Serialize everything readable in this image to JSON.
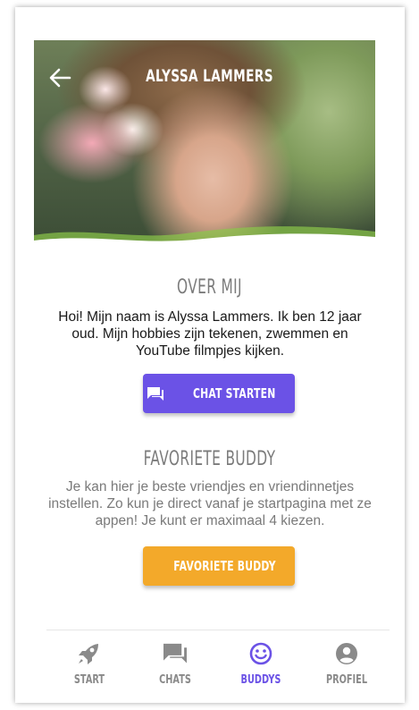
{
  "header": {
    "title": "ALYSSA LAMMERS"
  },
  "about": {
    "title": "OVER MIJ",
    "text": "Hoi! Mijn naam is Alyssa Lammers. Ik ben 12 jaar oud. Mijn hobbies zijn tekenen, zwemmen en YouTube filmpjes kijken."
  },
  "chat_button": {
    "label": "CHAT STARTEN",
    "icon": "chat-icon"
  },
  "favorite": {
    "title": "FAVORIETE BUDDY",
    "text": "Je kan hier je beste vriendjes en vriendinnetjes instellen. Zo kun je direct vanaf je startpagina met ze appen! Je kunt er maximaal 4 kiezen."
  },
  "favorite_button": {
    "label": "FAVORIETE BUDDY",
    "icon": "star-icon"
  },
  "tabs": [
    {
      "label": "START",
      "icon": "rocket-icon",
      "active": false
    },
    {
      "label": "CHATS",
      "icon": "chat-icon",
      "active": false
    },
    {
      "label": "BUDDYS",
      "icon": "smiley-icon",
      "active": true
    },
    {
      "label": "PROFIEL",
      "icon": "user-icon",
      "active": false
    }
  ],
  "colors": {
    "accent": "#6b52e6",
    "favorite": "#f3a92a",
    "tab_inactive": "#8a8a8a"
  }
}
